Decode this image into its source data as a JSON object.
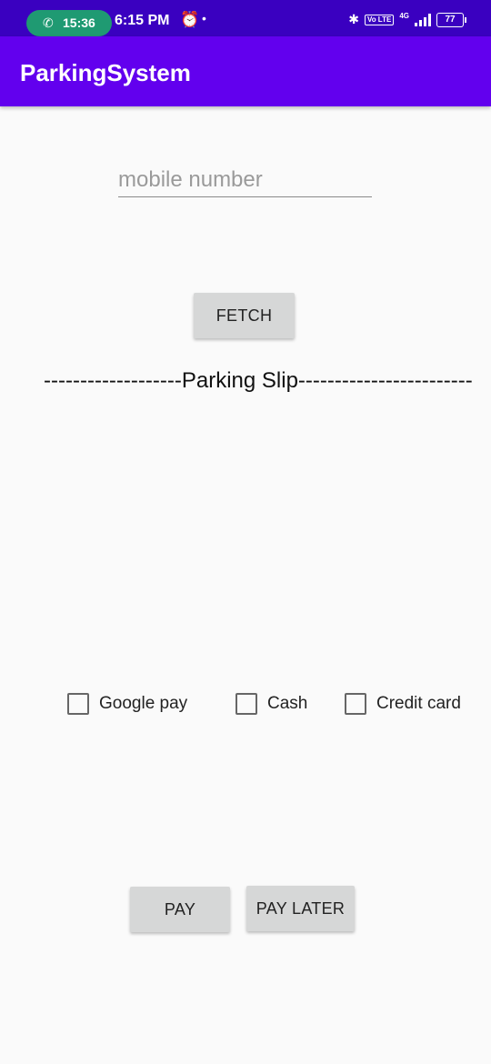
{
  "status_bar": {
    "call_time": "15:36",
    "clock": "6:15 PM",
    "network": "4G",
    "volte": "Vo LTE",
    "battery": "77"
  },
  "app_bar": {
    "title": "ParkingSystem",
    "color": "#6200ee"
  },
  "form": {
    "mobile_placeholder": "mobile number",
    "mobile_value": "",
    "fetch_label": "FETCH"
  },
  "slip": {
    "title": "-------------------Parking Slip------------------------"
  },
  "payment_methods": [
    {
      "label": "Google pay",
      "checked": false
    },
    {
      "label": "Cash",
      "checked": false
    },
    {
      "label": "Credit card",
      "checked": false
    }
  ],
  "actions": {
    "pay_label": "PAY",
    "pay_later_label": "PAY LATER"
  }
}
